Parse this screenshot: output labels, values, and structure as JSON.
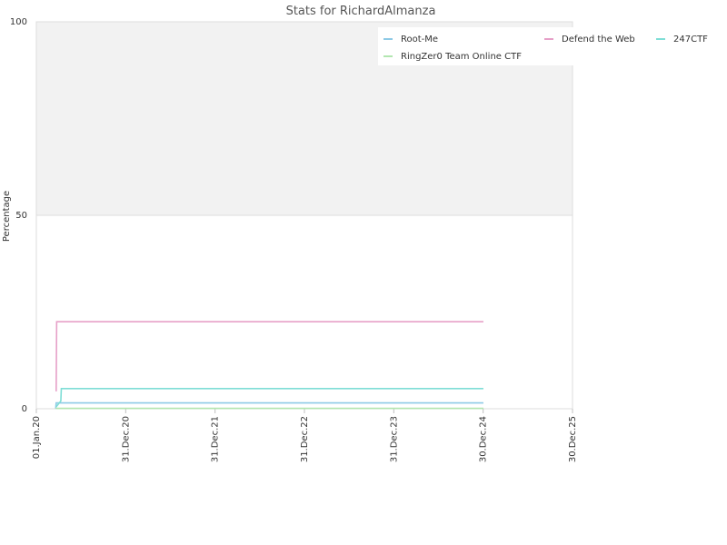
{
  "chart_data": {
    "type": "line",
    "title": "Stats for RichardAlmanza",
    "xlabel": "",
    "ylabel": "Percentage",
    "x_range": [
      "2020-01-01",
      "2025-12-30"
    ],
    "ylim": [
      0,
      100
    ],
    "y_ticks": [
      0,
      50,
      100
    ],
    "x_ticks": [
      {
        "date": "2020-01-01",
        "label": "01.Jan.20"
      },
      {
        "date": "2020-12-31",
        "label": "31.Dec.20"
      },
      {
        "date": "2021-12-31",
        "label": "31.Dec.21"
      },
      {
        "date": "2022-12-31",
        "label": "31.Dec.22"
      },
      {
        "date": "2023-12-31",
        "label": "31.Dec.23"
      },
      {
        "date": "2024-12-30",
        "label": "30.Dec.24"
      },
      {
        "date": "2025-12-30",
        "label": "30.Dec.25"
      }
    ],
    "band": {
      "from": 50,
      "to": 100,
      "color": "#f2f2f2"
    },
    "legend_placement": "top-right",
    "series": [
      {
        "name": "Root-Me",
        "color": "#8ecae6",
        "points": [
          [
            "2020-03-20",
            0.0
          ],
          [
            "2020-03-22",
            1.5
          ],
          [
            "2024-12-31",
            1.5
          ]
        ]
      },
      {
        "name": "Defend the Web",
        "color": "#e6a0c8",
        "points": [
          [
            "2020-03-22",
            4.5
          ],
          [
            "2020-03-24",
            22.5
          ],
          [
            "2024-12-31",
            22.5
          ]
        ]
      },
      {
        "name": "247CTF",
        "color": "#7fded6",
        "points": [
          [
            "2020-03-22",
            0.5
          ],
          [
            "2020-04-10",
            2.0
          ],
          [
            "2020-04-12",
            5.2
          ],
          [
            "2024-12-31",
            5.2
          ]
        ]
      },
      {
        "name": "RingZer0 Team Online CTF",
        "color": "#b2e6b0",
        "points": [
          [
            "2020-03-20",
            0.1
          ],
          [
            "2024-12-31",
            0.1
          ]
        ]
      }
    ]
  }
}
